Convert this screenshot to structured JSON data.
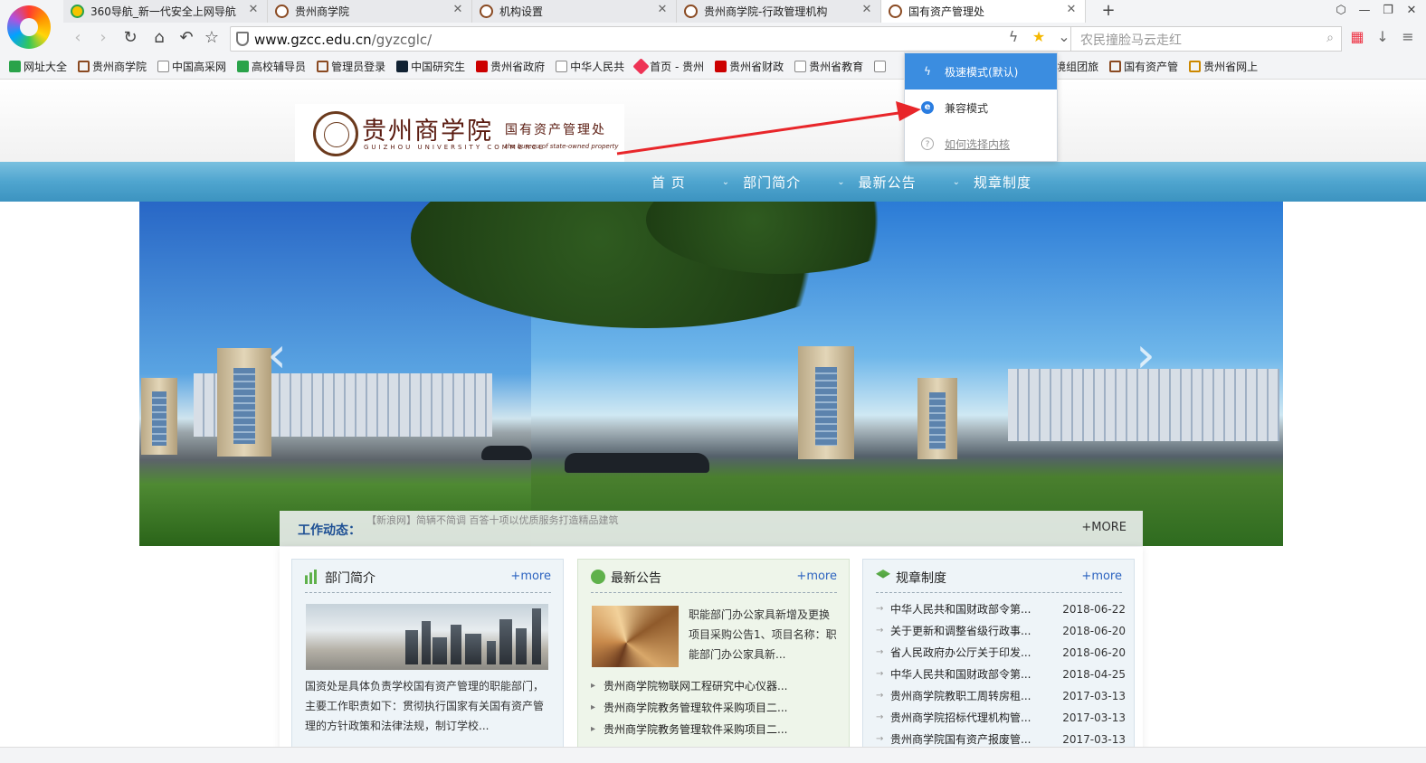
{
  "browser": {
    "tabs": [
      {
        "title": "360导航_新一代安全上网导航",
        "favicon": "360-icon",
        "active": false
      },
      {
        "title": "贵州商学院",
        "favicon": "seal-icon",
        "active": false
      },
      {
        "title": "机构设置",
        "favicon": "seal-icon",
        "active": false
      },
      {
        "title": "贵州商学院-行政管理机构",
        "favicon": "seal-icon",
        "active": false
      },
      {
        "title": "国有资产管理处",
        "favicon": "seal-icon",
        "active": true
      }
    ],
    "new_tab": "+",
    "address": {
      "host": "www.gzcc.edu.cn",
      "path": "/gyzcglc/"
    },
    "search_placeholder": "农民撞脸马云走红",
    "bookmarks": [
      {
        "label": "网址大全",
        "icon": "green"
      },
      {
        "label": "贵州商学院",
        "icon": "seal"
      },
      {
        "label": "中国高采网",
        "icon": "doc"
      },
      {
        "label": "高校辅导员",
        "icon": "green"
      },
      {
        "label": "管理员登录",
        "icon": "seal"
      },
      {
        "label": "中国研究生",
        "icon": "cap"
      },
      {
        "label": "贵州省政府",
        "icon": "red"
      },
      {
        "label": "中华人民共",
        "icon": "doc"
      },
      {
        "label": "首页 - 贵州",
        "icon": "dia"
      },
      {
        "label": "贵州省财政",
        "icon": "red"
      },
      {
        "label": "贵州省教育",
        "icon": "doc"
      },
      {
        "label": "",
        "icon": "doc"
      },
      {
        "label": "出境组团旅",
        "icon": "doc"
      },
      {
        "label": "国有资产管",
        "icon": "seal"
      },
      {
        "label": "贵州省网上",
        "icon": "seal"
      }
    ],
    "kernel_menu": {
      "items": [
        {
          "label": "极速模式(默认)",
          "icon": "lightning-icon",
          "selected": true
        },
        {
          "label": "兼容模式",
          "icon": "ie-icon",
          "selected": false
        },
        {
          "label": "如何选择内核",
          "icon": "help-icon",
          "selected": false
        }
      ]
    }
  },
  "site": {
    "brand": {
      "school_name": "贵州商学院",
      "school_en": "GUIZHOU UNIVERSITY COMMERCE",
      "dept_name": "国有资产管理处",
      "dept_en": "the bureau of state-owned property"
    },
    "nav": [
      {
        "label": "首 页"
      },
      {
        "label": "部门简介"
      },
      {
        "label": "最新公告"
      },
      {
        "label": "规章制度"
      }
    ],
    "ticker": {
      "label": "工作动态：",
      "text": "【新浪网】简辆不简调 百答十项以优质服务打造精品建筑",
      "more": "+MORE"
    },
    "panels": {
      "dept": {
        "title": "部门简介",
        "more": "+more",
        "desc": "国资处是具体负责学校国有资产管理的职能部门，主要工作职责如下：贯彻执行国家有关国有资产管理的方针政策和法律法规，制订学校..."
      },
      "notice": {
        "title": "最新公告",
        "more": "+more",
        "lead": "职能部门办公家具新增及更换项目采购公告1、项目名称：职能部门办公家具新...",
        "items": [
          "贵州商学院物联网工程研究中心仪器...",
          "贵州商学院教务管理软件采购项目二...",
          "贵州商学院教务管理软件采购项目二..."
        ]
      },
      "rules": {
        "title": "规章制度",
        "more": "+more",
        "items": [
          {
            "title": "中华人民共和国财政部令第...",
            "date": "2018-06-22"
          },
          {
            "title": "关于更新和调整省级行政事...",
            "date": "2018-06-20"
          },
          {
            "title": "省人民政府办公厅关于印发...",
            "date": "2018-06-20"
          },
          {
            "title": "中华人民共和国财政部令第...",
            "date": "2018-04-25"
          },
          {
            "title": "贵州商学院教职工周转房租...",
            "date": "2017-03-13"
          },
          {
            "title": "贵州商学院招标代理机构管...",
            "date": "2017-03-13"
          },
          {
            "title": "贵州商学院国有资产报废管...",
            "date": "2017-03-13"
          }
        ]
      }
    }
  },
  "colors": {
    "nav_blue": "#4fa5cf",
    "menu_selected": "#3b8de0",
    "arrow_red": "#e8262a",
    "more_link": "#2c63c0"
  }
}
